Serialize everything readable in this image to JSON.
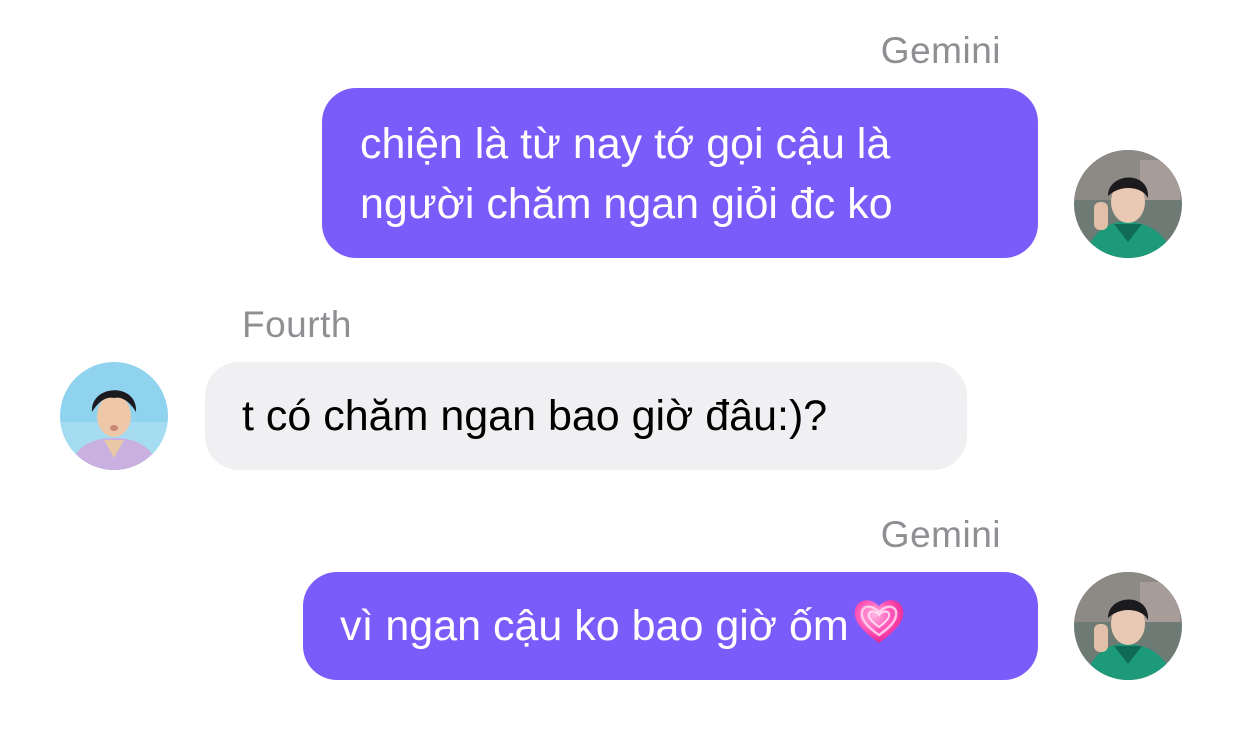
{
  "messages": [
    {
      "sender": "Gemini",
      "lines": [
        "chiện là từ nay tớ gọi cậu là",
        "người chăm ngan giỏi đc ko"
      ]
    },
    {
      "sender": "Fourth",
      "lines": [
        "t có chăm ngan bao giờ đâu:)?"
      ]
    },
    {
      "sender": "Gemini",
      "lines": [
        "vì ngan cậu ko bao giờ ốm"
      ],
      "emoji": "heart-icon"
    }
  ],
  "colors": {
    "outgoing_bubble": "#7a5cfa",
    "incoming_bubble": "#f0f0f2",
    "sender_name": "#8e8e93"
  }
}
